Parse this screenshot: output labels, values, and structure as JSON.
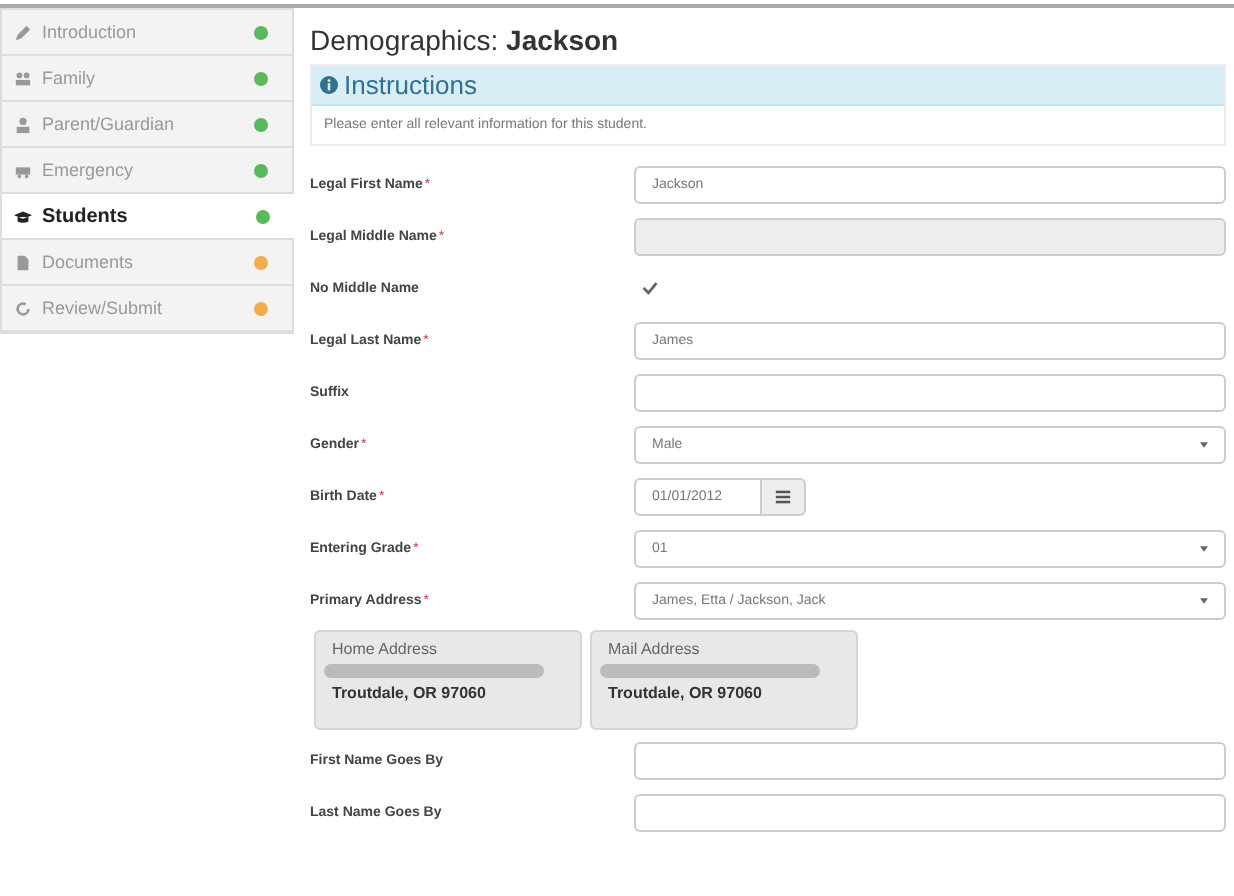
{
  "sidebar": {
    "items": [
      {
        "label": "Introduction",
        "selected": false,
        "color": "#5cb85c"
      },
      {
        "label": "Family",
        "selected": false,
        "color": "#5cb85c"
      },
      {
        "label": "Parent/Guardian",
        "selected": false,
        "color": "#5cb85c"
      },
      {
        "label": "Emergency",
        "selected": false,
        "color": "#5cb85c"
      },
      {
        "label": "Students",
        "selected": true,
        "color": "#5cb85c"
      },
      {
        "label": "Documents",
        "selected": false,
        "color": "#f0ad4e"
      },
      {
        "label": "Review/Submit",
        "selected": false,
        "color": "#f0ad4e"
      }
    ]
  },
  "page": {
    "title": "Demographics: ",
    "title_name": "Jackson"
  },
  "instructions": {
    "title": "Instructions",
    "text": "Please enter all relevant information for this student."
  },
  "fields": [
    {
      "kind": "text",
      "label": "Legal First Name",
      "mark": "*",
      "value": "Jackson"
    },
    {
      "kind": "text",
      "label": "Legal Middle Name",
      "mark": "*",
      "disabled": true
    },
    {
      "kind": "checkbox",
      "label": "No Middle Name",
      "checked": true
    },
    {
      "kind": "text",
      "label": "Legal Last Name",
      "mark": "*",
      "value": "James"
    },
    {
      "kind": "text",
      "label": "Suffix"
    },
    {
      "kind": "select",
      "label": "Gender",
      "mark": "*",
      "value": "Male"
    },
    {
      "kind": "date",
      "label": "Birth Date",
      "mark": "*",
      "value": "01/01/2012"
    },
    {
      "kind": "select",
      "label": "Entering Grade",
      "mark": "*",
      "value": "01"
    },
    {
      "kind": "select",
      "label": "Primary Address",
      "mark": "*",
      "value": "James, Etta / Jackson, Jack"
    },
    {
      "kind": "addresses",
      "cards": [
        {
          "title": "Home Address",
          "city": "Troutdale, OR 97060"
        },
        {
          "title": "Mail Address",
          "city": "Troutdale, OR 97060"
        }
      ]
    },
    {
      "kind": "text",
      "label": "First Name Goes By"
    },
    {
      "kind": "text",
      "label": "Last Name Goes By"
    }
  ]
}
